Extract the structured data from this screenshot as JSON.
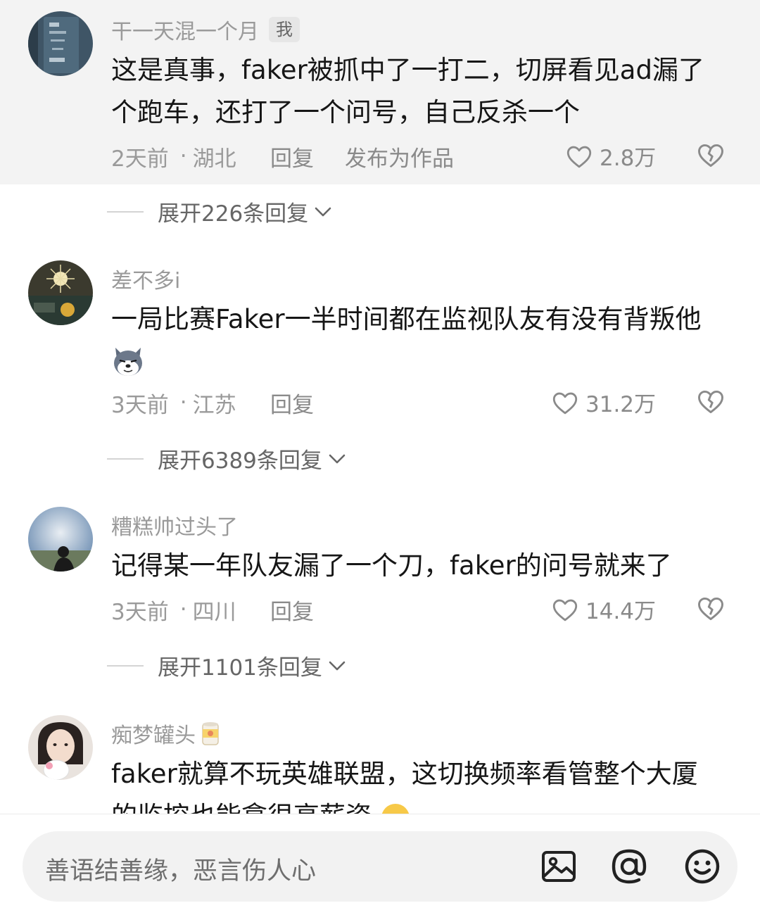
{
  "comments": [
    {
      "username": "干一天混一个月",
      "badge": "我",
      "text_line1": "这是真事，faker被抓中了一打二，切屏看见ad漏了",
      "text_line2": "个跑车，还打了一个问号，自己反杀一个",
      "time": "2天前",
      "location": "湖北",
      "reply": "回复",
      "publish": "发布为作品",
      "likes": "2.8万",
      "expand": "展开226条回复"
    },
    {
      "username": "差不多i",
      "text_line1": "一局比赛Faker一半时间都在监视队友有没有背叛他",
      "inline_emoji": "dog-emoji",
      "time": "3天前",
      "location": "江苏",
      "reply": "回复",
      "likes": "31.2万",
      "expand": "展开6389条回复"
    },
    {
      "username": "糟糕帅过头了",
      "text_line1": "记得某一年队友漏了一个刀，faker的问号就来了",
      "time": "3天前",
      "location": "四川",
      "reply": "回复",
      "likes": "14.4万",
      "expand": "展开1101条回复"
    },
    {
      "username": "痴梦罐头",
      "name_emoji": "can-emoji",
      "text_line1": "faker就算不玩英雄联盟，这切换频率看管整个大厦",
      "text_line2": "的监控也能拿很高薪资"
    }
  ],
  "separator": "·",
  "input": {
    "placeholder": "善语结善缘，恶言伤人心"
  },
  "icons": {
    "like": "heart-outline-icon",
    "dislike": "broken-heart-icon",
    "image": "image-icon",
    "mention": "at-icon",
    "emoji": "smiley-icon"
  },
  "colors": {
    "highlight_bg": "#f3f3f3",
    "meta_text": "#9a9a9a",
    "body_text": "#161616"
  }
}
